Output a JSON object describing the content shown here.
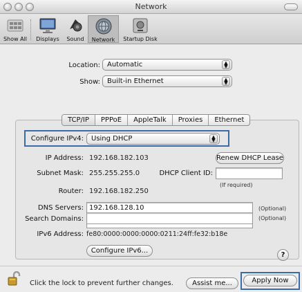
{
  "window": {
    "title": "Network"
  },
  "toolbar": {
    "items": [
      {
        "label": "Show All",
        "icon": "apple-grid-icon"
      },
      {
        "label": "Displays",
        "icon": "display-icon"
      },
      {
        "label": "Sound",
        "icon": "speaker-icon"
      },
      {
        "label": "Network",
        "icon": "network-globe-icon"
      },
      {
        "label": "Startup Disk",
        "icon": "startup-disk-icon"
      }
    ],
    "selected": "Network"
  },
  "location": {
    "label": "Location:",
    "value": "Automatic"
  },
  "show": {
    "label": "Show:",
    "value": "Built-in Ethernet"
  },
  "tabs": [
    "TCP/IP",
    "PPPoE",
    "AppleTalk",
    "Proxies",
    "Ethernet"
  ],
  "active_tab": "TCP/IP",
  "configure": {
    "label": "Configure IPv4:",
    "value": "Using DHCP"
  },
  "ip": {
    "label": "IP Address:",
    "value": "192.168.182.103"
  },
  "renew_button": "Renew DHCP Lease",
  "subnet": {
    "label": "Subnet Mask:",
    "value": "255.255.255.0"
  },
  "dhcp_client": {
    "label": "DHCP Client ID:",
    "value": "",
    "hint": "(If required)"
  },
  "router": {
    "label": "Router:",
    "value": "192.168.182.250"
  },
  "dns": {
    "label": "DNS Servers:",
    "value": "192.168.128.10",
    "hint": "(Optional)"
  },
  "search": {
    "label": "Search Domains:",
    "value": "",
    "hint": "(Optional)"
  },
  "ipv6": {
    "label": "IPv6 Address:",
    "value": "fe80:0000:0000:0000:0211:24ff:fe32:b18e"
  },
  "configure_ipv6_button": "Configure IPv6...",
  "help_button": "?",
  "footer": {
    "lock_text": "Click the lock to prevent further changes.",
    "assist_button": "Assist me...",
    "apply_button": "Apply Now"
  },
  "colors": {
    "highlight": "#3c69a8"
  }
}
